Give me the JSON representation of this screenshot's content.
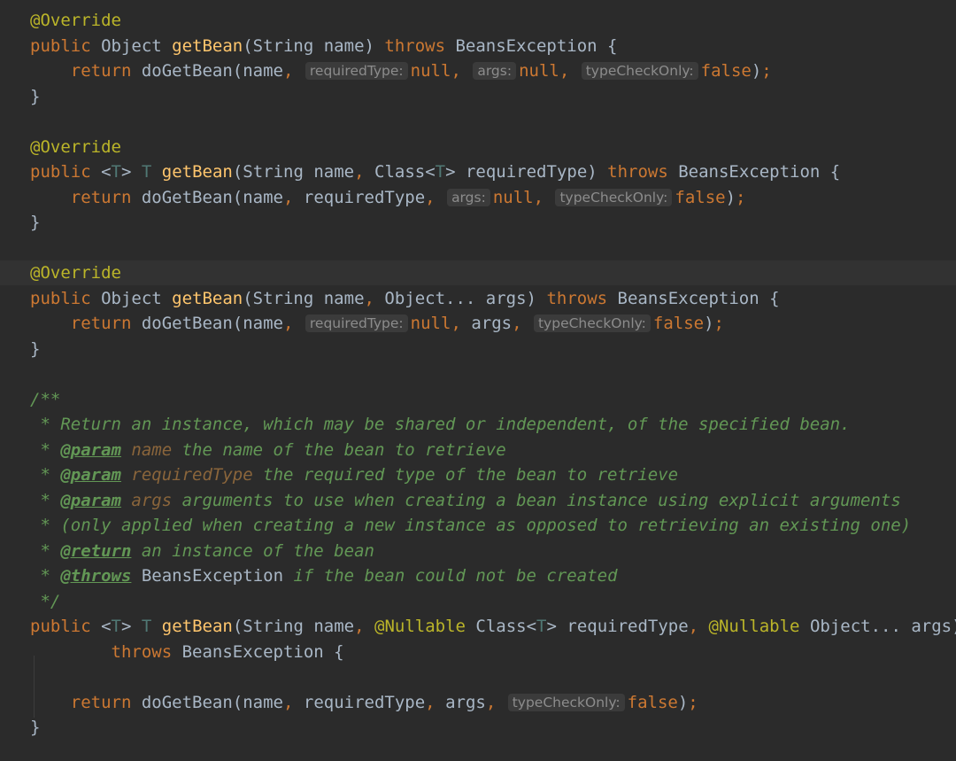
{
  "editor": {
    "language": "Java",
    "colors": {
      "background": "#2b2b2b",
      "current_line": "#323232",
      "keyword": "#cc7832",
      "annotation": "#bbb529",
      "method": "#ffc66d",
      "text": "#a9b7c6",
      "type_param": "#507874",
      "doc_comment": "#629755",
      "param_hint": "#8c8c8c"
    },
    "highlighted_line": 10,
    "lines": [
      [
        {
          "t": "@Override",
          "k": "annotation"
        }
      ],
      [
        {
          "t": "public ",
          "k": "keyword"
        },
        {
          "t": "Object ",
          "k": "plain"
        },
        {
          "t": "getBean",
          "k": "method"
        },
        {
          "t": "(String name) ",
          "k": "plain"
        },
        {
          "t": "throws ",
          "k": "keyword"
        },
        {
          "t": "BeansException {",
          "k": "plain"
        }
      ],
      [
        {
          "t": "    return ",
          "k": "keyword"
        },
        {
          "t": "doGetBean(name",
          "k": "plain"
        },
        {
          "t": ", ",
          "k": "keyword"
        },
        {
          "t": "requiredType:",
          "k": "hint"
        },
        {
          "t": "null",
          "k": "keyword"
        },
        {
          "t": ", ",
          "k": "keyword"
        },
        {
          "t": "args:",
          "k": "hint"
        },
        {
          "t": "null",
          "k": "keyword"
        },
        {
          "t": ", ",
          "k": "keyword"
        },
        {
          "t": "typeCheckOnly:",
          "k": "hint"
        },
        {
          "t": "false",
          "k": "keyword"
        },
        {
          "t": ")",
          "k": "plain"
        },
        {
          "t": ";",
          "k": "keyword"
        }
      ],
      [
        {
          "t": "}",
          "k": "plain"
        }
      ],
      [],
      [
        {
          "t": "@Override",
          "k": "annotation"
        }
      ],
      [
        {
          "t": "public ",
          "k": "keyword"
        },
        {
          "t": "<",
          "k": "plain"
        },
        {
          "t": "T",
          "k": "type-param"
        },
        {
          "t": "> ",
          "k": "plain"
        },
        {
          "t": "T ",
          "k": "type-param"
        },
        {
          "t": "getBean",
          "k": "method"
        },
        {
          "t": "(String name",
          "k": "plain"
        },
        {
          "t": ", ",
          "k": "keyword"
        },
        {
          "t": "Class<",
          "k": "plain"
        },
        {
          "t": "T",
          "k": "type-param"
        },
        {
          "t": "> requiredType) ",
          "k": "plain"
        },
        {
          "t": "throws ",
          "k": "keyword"
        },
        {
          "t": "BeansException {",
          "k": "plain"
        }
      ],
      [
        {
          "t": "    return ",
          "k": "keyword"
        },
        {
          "t": "doGetBean(name",
          "k": "plain"
        },
        {
          "t": ", ",
          "k": "keyword"
        },
        {
          "t": "requiredType",
          "k": "plain"
        },
        {
          "t": ", ",
          "k": "keyword"
        },
        {
          "t": "args:",
          "k": "hint"
        },
        {
          "t": "null",
          "k": "keyword"
        },
        {
          "t": ", ",
          "k": "keyword"
        },
        {
          "t": "typeCheckOnly:",
          "k": "hint"
        },
        {
          "t": "false",
          "k": "keyword"
        },
        {
          "t": ")",
          "k": "plain"
        },
        {
          "t": ";",
          "k": "keyword"
        }
      ],
      [
        {
          "t": "}",
          "k": "plain"
        }
      ],
      [],
      [
        {
          "t": "@Override",
          "k": "annotation"
        }
      ],
      [
        {
          "t": "public ",
          "k": "keyword"
        },
        {
          "t": "Object ",
          "k": "plain"
        },
        {
          "t": "getBean",
          "k": "method"
        },
        {
          "t": "(String name",
          "k": "plain"
        },
        {
          "t": ", ",
          "k": "keyword"
        },
        {
          "t": "Object... args) ",
          "k": "plain"
        },
        {
          "t": "throws ",
          "k": "keyword"
        },
        {
          "t": "BeansException {",
          "k": "plain"
        }
      ],
      [
        {
          "t": "    return ",
          "k": "keyword"
        },
        {
          "t": "doGetBean(name",
          "k": "plain"
        },
        {
          "t": ", ",
          "k": "keyword"
        },
        {
          "t": "requiredType:",
          "k": "hint"
        },
        {
          "t": "null",
          "k": "keyword"
        },
        {
          "t": ", ",
          "k": "keyword"
        },
        {
          "t": "args",
          "k": "plain"
        },
        {
          "t": ", ",
          "k": "keyword"
        },
        {
          "t": "typeCheckOnly:",
          "k": "hint"
        },
        {
          "t": "false",
          "k": "keyword"
        },
        {
          "t": ")",
          "k": "plain"
        },
        {
          "t": ";",
          "k": "keyword"
        }
      ],
      [
        {
          "t": "}",
          "k": "plain"
        }
      ],
      [],
      [
        {
          "t": "/**",
          "k": "doc-comment"
        }
      ],
      [
        {
          "t": " * Return an instance, which may be shared or independent, of the specified bean.",
          "k": "doc-comment"
        }
      ],
      [
        {
          "t": " * ",
          "k": "doc-comment"
        },
        {
          "t": "@param",
          "k": "doc-tag"
        },
        {
          "t": " name",
          "k": "doc-param"
        },
        {
          "t": " the name of the bean to retrieve",
          "k": "doc-comment"
        }
      ],
      [
        {
          "t": " * ",
          "k": "doc-comment"
        },
        {
          "t": "@param",
          "k": "doc-tag"
        },
        {
          "t": " requiredType",
          "k": "doc-param"
        },
        {
          "t": " the required type of the bean to retrieve",
          "k": "doc-comment"
        }
      ],
      [
        {
          "t": " * ",
          "k": "doc-comment"
        },
        {
          "t": "@param",
          "k": "doc-tag"
        },
        {
          "t": " args",
          "k": "doc-param"
        },
        {
          "t": " arguments to use when creating a bean instance using explicit arguments",
          "k": "doc-comment"
        }
      ],
      [
        {
          "t": " * (only applied when creating a new instance as opposed to retrieving an existing one)",
          "k": "doc-comment"
        }
      ],
      [
        {
          "t": " * ",
          "k": "doc-comment"
        },
        {
          "t": "@return",
          "k": "doc-tag"
        },
        {
          "t": " an instance of the bean",
          "k": "doc-comment"
        }
      ],
      [
        {
          "t": " * ",
          "k": "doc-comment"
        },
        {
          "t": "@throws",
          "k": "doc-tag"
        },
        {
          "t": " ",
          "k": "doc-comment"
        },
        {
          "t": "BeansException",
          "k": "doc-code"
        },
        {
          "t": " if the bean could not be created",
          "k": "doc-comment"
        }
      ],
      [
        {
          "t": " */",
          "k": "doc-comment"
        }
      ],
      [
        {
          "t": "public ",
          "k": "keyword"
        },
        {
          "t": "<",
          "k": "plain"
        },
        {
          "t": "T",
          "k": "type-param"
        },
        {
          "t": "> ",
          "k": "plain"
        },
        {
          "t": "T ",
          "k": "type-param"
        },
        {
          "t": "getBean",
          "k": "method"
        },
        {
          "t": "(String name",
          "k": "plain"
        },
        {
          "t": ", ",
          "k": "keyword"
        },
        {
          "t": "@Nullable ",
          "k": "annotation"
        },
        {
          "t": "Class<",
          "k": "plain"
        },
        {
          "t": "T",
          "k": "type-param"
        },
        {
          "t": "> requiredType",
          "k": "plain"
        },
        {
          "t": ", ",
          "k": "keyword"
        },
        {
          "t": "@Nullable ",
          "k": "annotation"
        },
        {
          "t": "Object... args)",
          "k": "plain"
        }
      ],
      [
        {
          "t": "        throws ",
          "k": "keyword"
        },
        {
          "t": "BeansException {",
          "k": "plain"
        }
      ],
      [],
      [
        {
          "t": "    return ",
          "k": "keyword"
        },
        {
          "t": "doGetBean(name",
          "k": "plain"
        },
        {
          "t": ", ",
          "k": "keyword"
        },
        {
          "t": "requiredType",
          "k": "plain"
        },
        {
          "t": ", ",
          "k": "keyword"
        },
        {
          "t": "args",
          "k": "plain"
        },
        {
          "t": ", ",
          "k": "keyword"
        },
        {
          "t": "typeCheckOnly:",
          "k": "hint"
        },
        {
          "t": "false",
          "k": "keyword"
        },
        {
          "t": ")",
          "k": "plain"
        },
        {
          "t": ";",
          "k": "keyword"
        }
      ],
      [
        {
          "t": "}",
          "k": "plain"
        }
      ]
    ]
  }
}
